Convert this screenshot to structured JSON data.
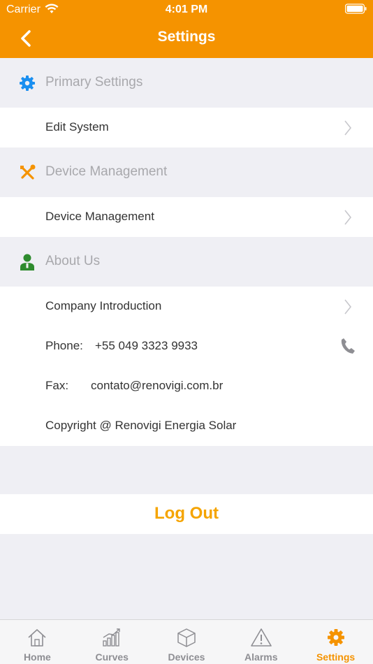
{
  "status_bar": {
    "carrier": "Carrier",
    "time": "4:01 PM"
  },
  "nav": {
    "title": "Settings"
  },
  "sections": {
    "primary": {
      "title": "Primary Settings",
      "icon": "gear-icon",
      "items": [
        "Edit System"
      ]
    },
    "device": {
      "title": "Device Management",
      "icon": "wrench-screwdriver-icon",
      "items": [
        "Device Management"
      ]
    },
    "about": {
      "title": "About Us",
      "icon": "person-icon",
      "company_intro": "Company Introduction",
      "phone_label": "Phone:",
      "phone_value": "+55 049 3323 9933",
      "fax_label": "Fax:",
      "fax_value": "contato@renovigi.com.br",
      "copyright": "Copyright @ Renovigi Energia Solar"
    }
  },
  "logout_label": "Log Out",
  "tabs": [
    {
      "label": "Home",
      "icon": "home-icon"
    },
    {
      "label": "Curves",
      "icon": "chart-icon"
    },
    {
      "label": "Devices",
      "icon": "box-icon"
    },
    {
      "label": "Alarms",
      "icon": "warning-icon"
    },
    {
      "label": "Settings",
      "icon": "gear-icon",
      "active": true
    }
  ],
  "colors": {
    "accent": "#f59300",
    "logout": "#f5a400",
    "primary_icon": "#1a8ff0",
    "about_icon": "#2e8b2e"
  }
}
